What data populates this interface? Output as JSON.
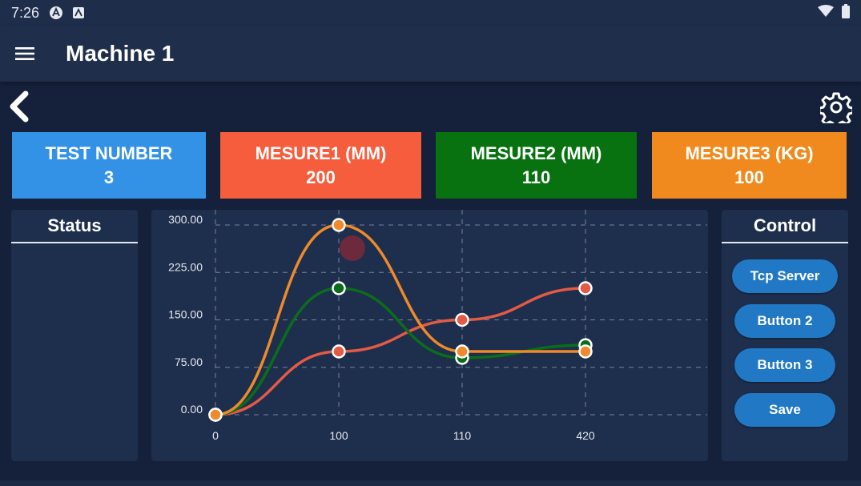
{
  "status_bar": {
    "time": "7:26"
  },
  "app_bar": {
    "title": "Machine 1"
  },
  "cards": [
    {
      "label": "TEST NUMBER",
      "value": "3",
      "color": "#3492e6"
    },
    {
      "label": "MESURE1 (MM)",
      "value": "200",
      "color": "#f55d3c"
    },
    {
      "label": "MESURE2 (MM)",
      "value": "110",
      "color": "#07720f"
    },
    {
      "label": "MESURE3 (KG)",
      "value": "100",
      "color": "#f08a1e"
    }
  ],
  "status_panel": {
    "title": "Status"
  },
  "control_panel": {
    "title": "Control",
    "buttons": [
      "Tcp Server",
      "Button 2",
      "Button 3",
      "Save"
    ]
  },
  "colors": {
    "background": "#15203a",
    "panel": "#1e2e4d",
    "button": "#2179c6"
  },
  "chart_data": {
    "type": "line",
    "categories": [
      "0",
      "100",
      "110",
      "420"
    ],
    "ylim": [
      0,
      300
    ],
    "y_ticks": [
      "0.00",
      "75.00",
      "150.00",
      "225.00",
      "300.00"
    ],
    "grid": true,
    "series": [
      {
        "color": "#e35a45",
        "values": [
          0,
          100,
          150,
          200
        ]
      },
      {
        "color": "#0b6d1a",
        "values": [
          0,
          200,
          90,
          110
        ]
      },
      {
        "color": "#ee8a2a",
        "values": [
          0,
          300,
          100,
          100
        ]
      }
    ]
  }
}
